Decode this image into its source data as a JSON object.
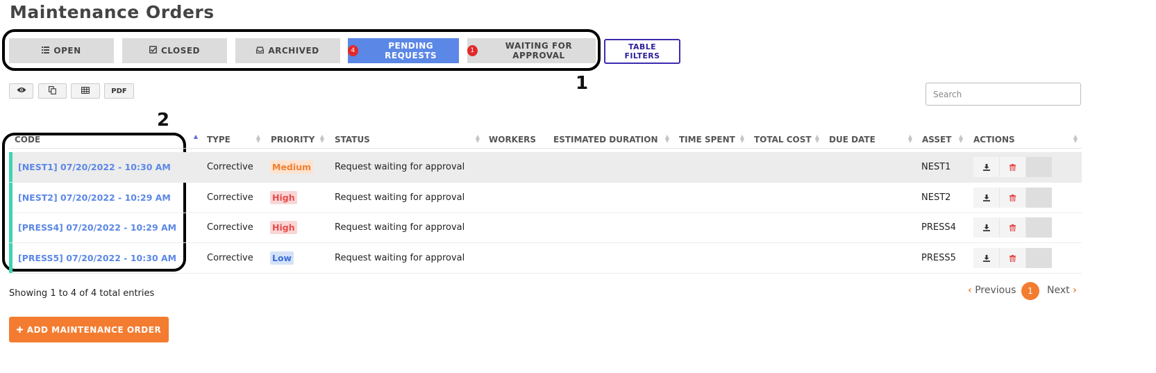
{
  "page": {
    "title": "Maintenance Orders"
  },
  "tabs": [
    {
      "label": "OPEN",
      "icon": "list-icon",
      "badge": null,
      "active": false
    },
    {
      "label": "CLOSED",
      "icon": "check-square-icon",
      "badge": null,
      "active": false
    },
    {
      "label": "ARCHIVED",
      "icon": "inbox-icon",
      "badge": null,
      "active": false
    },
    {
      "label": "PENDING REQUESTS",
      "icon": null,
      "badge": "4",
      "active": true
    },
    {
      "label": "WAITING FOR APPROVAL",
      "icon": null,
      "badge": "1",
      "active": false
    }
  ],
  "table_filters_label": "TABLE FILTERS",
  "annotations": {
    "one": "1",
    "two": "2"
  },
  "toolbar": {
    "pdf_label": "PDF"
  },
  "search": {
    "placeholder": "Search",
    "value": ""
  },
  "table": {
    "columns": [
      "CODE",
      "TYPE",
      "PRIORITY",
      "STATUS",
      "WORKERS",
      "ESTIMATED DURATION",
      "TIME SPENT",
      "TOTAL COST",
      "DUE DATE",
      "ASSET",
      "ACTIONS"
    ],
    "rows": [
      {
        "code": "[NEST1] 07/20/2022 - 10:30 AM",
        "type": "Corrective",
        "priority": "Medium",
        "status": "Request waiting for approval",
        "workers": "",
        "estimated_duration": "",
        "time_spent": "",
        "total_cost": "",
        "due_date": "",
        "asset": "NEST1"
      },
      {
        "code": "[NEST2] 07/20/2022 - 10:29 AM",
        "type": "Corrective",
        "priority": "High",
        "status": "Request waiting for approval",
        "workers": "",
        "estimated_duration": "",
        "time_spent": "",
        "total_cost": "",
        "due_date": "",
        "asset": "NEST2"
      },
      {
        "code": "[PRESS4] 07/20/2022 - 10:29 AM",
        "type": "Corrective",
        "priority": "High",
        "status": "Request waiting for approval",
        "workers": "",
        "estimated_duration": "",
        "time_spent": "",
        "total_cost": "",
        "due_date": "",
        "asset": "PRESS4"
      },
      {
        "code": "[PRESS5] 07/20/2022 - 10:30 AM",
        "type": "Corrective",
        "priority": "Low",
        "status": "Request waiting for approval",
        "workers": "",
        "estimated_duration": "",
        "time_spent": "",
        "total_cost": "",
        "due_date": "",
        "asset": "PRESS5"
      }
    ]
  },
  "priority_colors": {
    "Medium": {
      "fg": "#f08030",
      "bg": "#fde3cf"
    },
    "High": {
      "fg": "#e84c4c",
      "bg": "#f9d6d6"
    },
    "Low": {
      "fg": "#3a6fd8",
      "bg": "#d4e2f7"
    }
  },
  "footer": {
    "showing": "Showing 1 to 4 of 4 total entries",
    "previous": "Previous",
    "page": "1",
    "next": "Next"
  },
  "add_button_label": "ADD MAINTENANCE ORDER",
  "colors": {
    "accent": "#f47c30",
    "active_tab": "#5b87e6",
    "row_marker": "#3ed3b0",
    "badge": "#e02a2a"
  }
}
